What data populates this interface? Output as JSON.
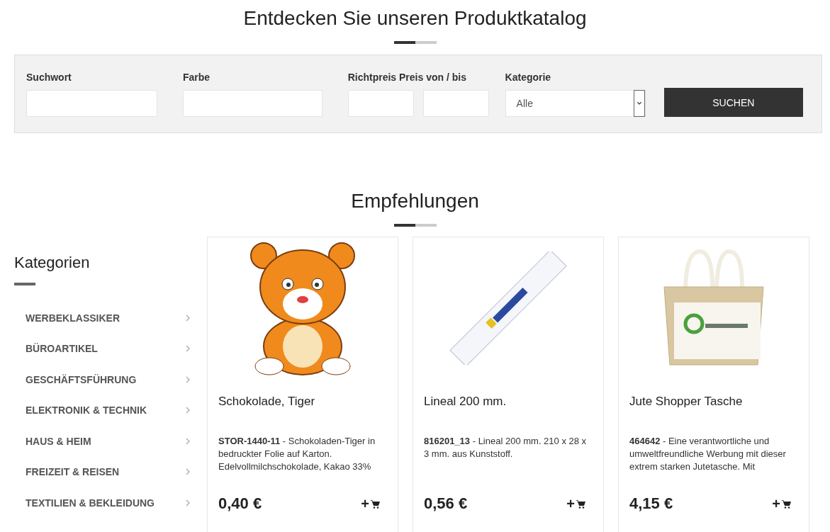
{
  "catalog": {
    "title": "Entdecken Sie unseren Produktkatalog"
  },
  "search": {
    "fields": [
      {
        "kind": "text",
        "label": "Suchwort"
      },
      {
        "kind": "text",
        "label": "Farbe"
      },
      {
        "kind": "range",
        "label": "Richtpreis Preis von / bis"
      },
      {
        "kind": "select",
        "label": "Kategorie",
        "value": "Alle"
      }
    ],
    "button": "SUCHEN"
  },
  "recommendations": {
    "title": "Empfehlungen"
  },
  "sidebar": {
    "title": "Kategorien",
    "items": [
      {
        "label": "WERBEKLASSIKER"
      },
      {
        "label": "BÜROARTIKEL"
      },
      {
        "label": "GESCHÄFTSFÜHRUNG"
      },
      {
        "label": "ELEKTRONIK & TECHNIK"
      },
      {
        "label": "HAUS & HEIM"
      },
      {
        "label": "FREIZEIT & REISEN"
      },
      {
        "label": "TEXTILIEN & BEKLEIDUNG"
      }
    ]
  },
  "products": [
    {
      "kind": "tiger",
      "name": "Schokolade, Tiger",
      "description": "**STOR-1440-11** - Schokoladen-Tiger in bedruckter Folie auf Karton. Edelvollmilchschokolade, Kakao 33%",
      "price": "0,40 €",
      "add": "+"
    },
    {
      "kind": "ruler",
      "name": "Lineal 200 mm.",
      "description": "**816201_13** - Lineal 200 mm. 210 x 28 x 3 mm. aus Kunststoff.",
      "price": "0,56 €",
      "add": "+"
    },
    {
      "kind": "bag",
      "name": "Jute Shopper Tasche",
      "description": "**464642** - Eine verantwortliche und umweltfreundliche Werbung mit dieser extrem starken Jutetasche. Mit",
      "price": "4,15 €",
      "add": "+"
    }
  ]
}
